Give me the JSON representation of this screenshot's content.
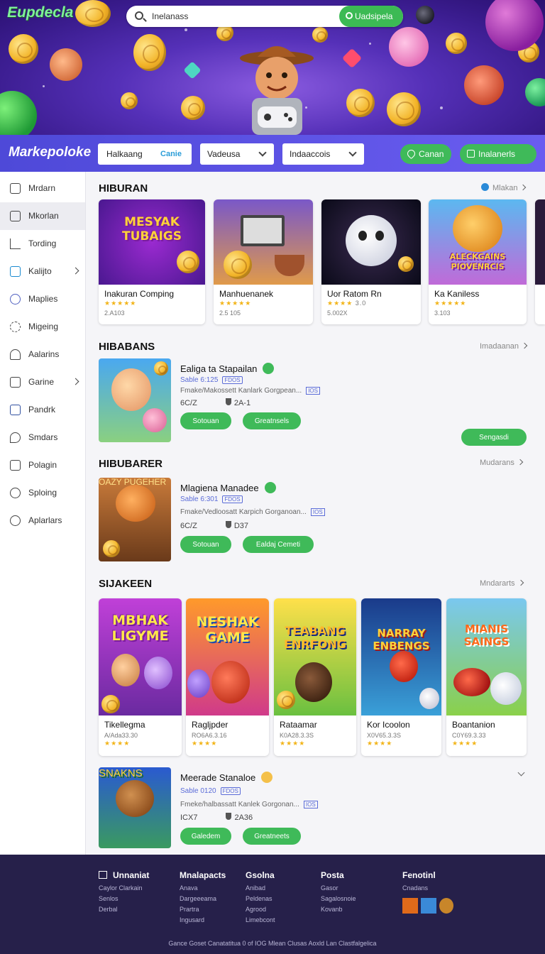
{
  "header": {
    "brand": "Eupdecla",
    "search_value": "Inelanass",
    "search_button": "Uadsipela"
  },
  "navbar": {
    "logo": "Markepoloke",
    "input_value": "Halkaang",
    "input_tag": "Canie",
    "select1": "Vadeusa",
    "select2": "Indaaccois",
    "btn1": "Canan",
    "btn2": "Inalanerls"
  },
  "sidebar": {
    "items": [
      {
        "label": "Mrdarn",
        "icon": "home-icon"
      },
      {
        "label": "Mkorlan",
        "icon": "folder-icon"
      },
      {
        "label": "Tording",
        "icon": "trending-icon"
      },
      {
        "label": "Kalijto",
        "icon": "monitor-icon"
      },
      {
        "label": "Maplies",
        "icon": "globe-icon"
      },
      {
        "label": "Migeing",
        "icon": "settings-icon"
      },
      {
        "label": "Aalarins",
        "icon": "user-icon"
      },
      {
        "label": "Garine",
        "icon": "document-icon"
      },
      {
        "label": "Pandrk",
        "icon": "media-icon"
      },
      {
        "label": "Smdars",
        "icon": "pin-icon"
      },
      {
        "label": "Polagin",
        "icon": "calendar-icon"
      },
      {
        "label": "Sploing",
        "icon": "clock-icon"
      },
      {
        "label": "Aplarlars",
        "icon": "history-icon"
      }
    ]
  },
  "section1": {
    "title": "HIBURAN",
    "link": "Mlakan",
    "cards": [
      {
        "title": "Inakuran Comping",
        "sub": "2.A103",
        "art": "MESYAK TUBAIGS"
      },
      {
        "title": "Manhuenanek",
        "sub": "2.5 105",
        "art": ""
      },
      {
        "title": "Uor Ratom Rn",
        "sub": "5.002X",
        "rating": "3.0",
        "art": ""
      },
      {
        "title": "Ka Kaniless",
        "sub": "3.103",
        "art": "ALECKGAINS PIOVENRCIS"
      }
    ]
  },
  "section2": {
    "title": "HIBABANS",
    "link": "Imadaanan",
    "right_button": "Sengasdi",
    "item": {
      "title": "Ealiga ta Stapailan",
      "sub": "Sable 6:125",
      "tag": "FDOS",
      "desc": "Fmake/Makossett Kanlark Gorgpean...",
      "desc_tag": "IOS",
      "meta1": "6C/Z",
      "meta2": "2A-1",
      "btn1": "Sotouan",
      "btn2": "Greatnsels"
    }
  },
  "section3": {
    "title": "HIBUBARER",
    "link": "Mudarans",
    "item": {
      "title": "Mlagiena Manadee",
      "sub": "Sable 6:301",
      "tag": "FDOS",
      "desc": "Fmake/Vedloosatt Karpich Gorganoan...",
      "desc_tag": "IOS",
      "meta1": "6C/Z",
      "meta2": "D37",
      "btn1": "Sotouan",
      "btn2": "Ealdaj Cemeti",
      "art": "OAZY PUGEHER"
    }
  },
  "section4": {
    "title": "SIJAKEEN",
    "link": "Mndararts",
    "cards": [
      {
        "title": "Tikellegma",
        "sub": "A/Ada33.30",
        "art": "MBHAK LIGYME"
      },
      {
        "title": "Ragljpder",
        "sub": "RO6A6.3.16",
        "art": "NESHAK GAME"
      },
      {
        "title": "Rataamar",
        "sub": "K0A28.3.3S",
        "art": "TEABANG ENRFONG"
      },
      {
        "title": "Kor Icoolon",
        "sub": "X0V65.3.3S",
        "art": "NARRAY ENBENGS"
      },
      {
        "title": "Boantanion",
        "sub": "C0Y69.3.33",
        "art": "MIANIS SAINGS"
      }
    ]
  },
  "section5": {
    "item": {
      "title": "Meerade Stanaloe",
      "sub": "Sable 0120",
      "tag": "FDOS",
      "desc": "Fmeke/halbassatt Kanlek Gorgonan...",
      "desc_tag": "IOS",
      "meta1": "ICX7",
      "meta2": "2A36",
      "btn1": "Galedem",
      "btn2": "Greatneets",
      "art": "SNAKNS"
    }
  },
  "footer": {
    "col1": {
      "title": "Unnaniat",
      "links": [
        "Caylor Clarkain",
        "Senlos",
        "Derbal"
      ]
    },
    "col2": {
      "title": "Mnalapacts",
      "links": [
        "Anava",
        "Dargeeeama",
        "Prartra",
        "Ingusard"
      ]
    },
    "col3": {
      "title": "Gsolna",
      "links": [
        "Anibad",
        "Peldenas",
        "Agrood",
        "Limebcont"
      ]
    },
    "col4": {
      "title": "Posta",
      "links": [
        "Gasor",
        "Sagalosnoie",
        "Kovanb"
      ]
    },
    "col5": {
      "title": "Fenotinl",
      "links": [
        "Cnadans"
      ]
    },
    "copyright": "Gance Goset Canatatitua 0 of IOG Mlean Clusas Aoxld Lan Clastfalgelica"
  },
  "colors": {
    "hero": "#4a23a6",
    "navbar": "#5a52e6",
    "accent_green": "#3fba59",
    "footer": "#26204a",
    "star": "#f2b418"
  }
}
